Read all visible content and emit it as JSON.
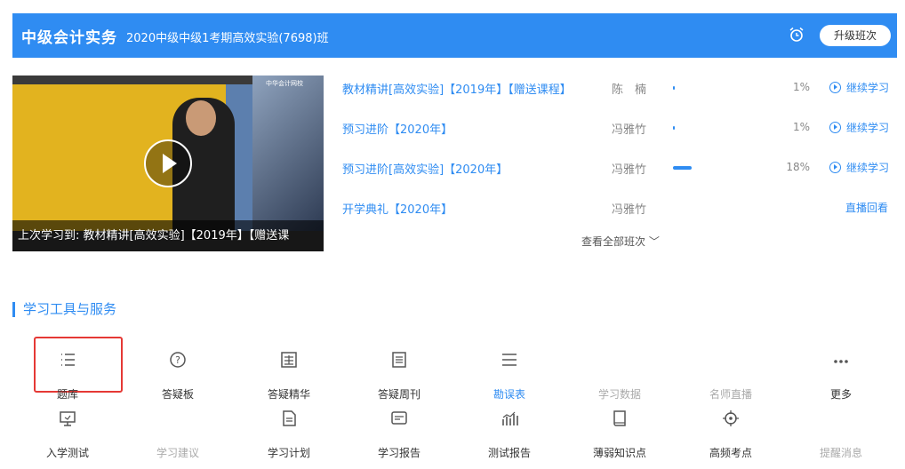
{
  "header": {
    "subject": "中级会计实务",
    "class_name": "2020中级中级1考期高效实验(7698)班",
    "upgrade_label": "升级班次"
  },
  "video": {
    "logo_text": "中华会计网校",
    "caption": "上次学习到:  教材精讲[高效实验]【2019年】【赠送课"
  },
  "courses": [
    {
      "name": "教材精讲[高效实验]【2019年】【赠送课程】",
      "teacher": "陈　楠",
      "progress": 1,
      "progress_label": "1%",
      "action": "继续学习"
    },
    {
      "name": "预习进阶【2020年】",
      "teacher": "冯雅竹",
      "progress": 1,
      "progress_label": "1%",
      "action": "继续学习"
    },
    {
      "name": "预习进阶[高效实验]【2020年】",
      "teacher": "冯雅竹",
      "progress": 18,
      "progress_label": "18%",
      "action": "继续学习"
    },
    {
      "name": "开学典礼【2020年】",
      "teacher": "冯雅竹",
      "progress": null,
      "progress_label": "",
      "action": "直播回看"
    }
  ],
  "view_all_label": "查看全部班次 ﹀",
  "section_title": "学习工具与服务",
  "tools_row1": [
    {
      "label": "题库",
      "icon": "list-icon"
    },
    {
      "label": "答疑板",
      "icon": "question-icon"
    },
    {
      "label": "答疑精华",
      "icon": "jing-icon"
    },
    {
      "label": "答疑周刊",
      "icon": "doc-icon"
    },
    {
      "label": "勘误表",
      "icon": "menu-icon"
    },
    {
      "label": "学习数据",
      "icon": ""
    },
    {
      "label": "名师直播",
      "icon": ""
    },
    {
      "label": "更多",
      "icon": "more-icon"
    }
  ],
  "tools_row2": [
    {
      "label": "入学测试",
      "icon": "monitor-icon"
    },
    {
      "label": "学习建议",
      "icon": ""
    },
    {
      "label": "学习计划",
      "icon": "plan-icon"
    },
    {
      "label": "学习报告",
      "icon": "report-icon"
    },
    {
      "label": "测试报告",
      "icon": "chart-icon"
    },
    {
      "label": "薄弱知识点",
      "icon": "book-icon"
    },
    {
      "label": "高频考点",
      "icon": "target-icon"
    },
    {
      "label": "提醒消息",
      "icon": ""
    }
  ]
}
